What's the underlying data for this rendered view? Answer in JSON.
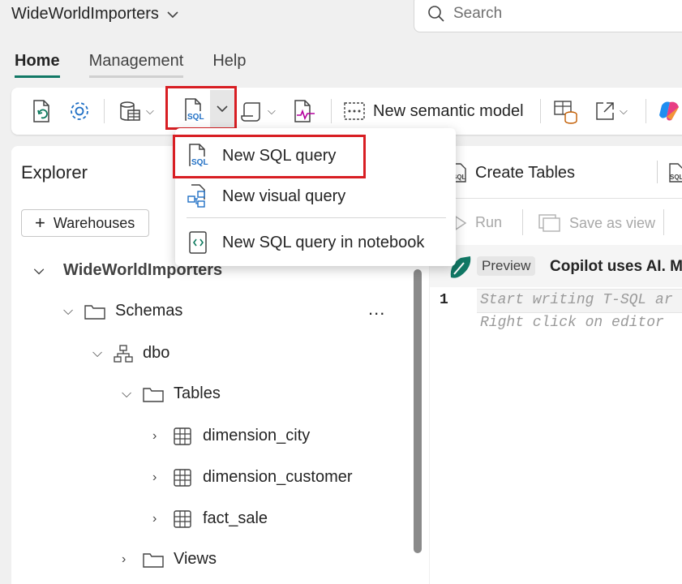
{
  "workspace": {
    "name": "WideWorldImporters"
  },
  "search": {
    "placeholder": "Search"
  },
  "tabs": [
    {
      "label": "Home"
    },
    {
      "label": "Management"
    },
    {
      "label": "Help"
    }
  ],
  "ribbon": {
    "new_semantic_model": "New semantic model"
  },
  "menu": {
    "items": [
      {
        "label": "New SQL query"
      },
      {
        "label": "New visual query"
      },
      {
        "label": "New SQL query in notebook"
      }
    ]
  },
  "explorer": {
    "title": "Explorer",
    "add_button": "Warehouses",
    "root": "WideWorldImporters",
    "schemas": "Schemas",
    "dbo": "dbo",
    "tables": "Tables",
    "table_items": [
      "dimension_city",
      "dimension_customer",
      "fact_sale"
    ],
    "views": "Views",
    "more": "..."
  },
  "editor": {
    "tab_label": "Create Tables",
    "run": "Run",
    "save_as_view": "Save as view",
    "preview_badge": "Preview",
    "copilot_text": "Copilot uses AI. M",
    "line_number": "1",
    "placeholder_line1": "Start writing T-SQL ar",
    "placeholder_line2": "Right click on editor"
  },
  "colors": {
    "accent": "#117865",
    "highlight_red": "#d81e23"
  }
}
